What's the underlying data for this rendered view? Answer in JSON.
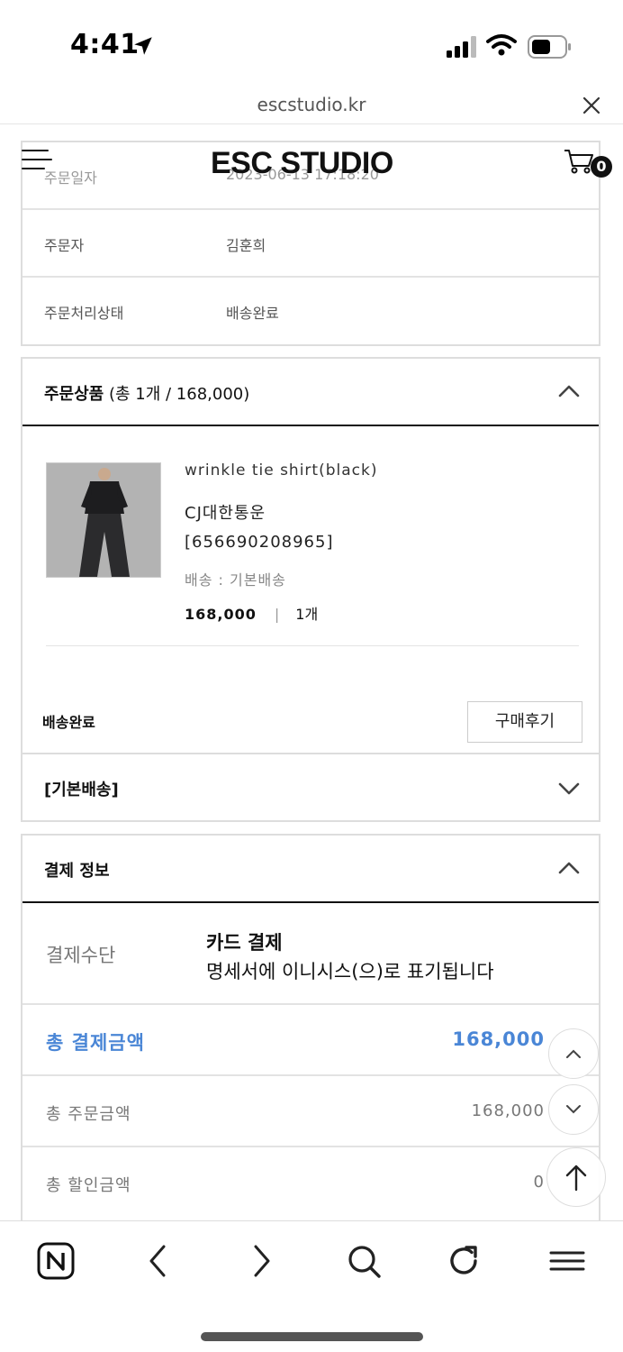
{
  "status_bar": {
    "time": "4:41"
  },
  "browser": {
    "url": "escstudio.kr"
  },
  "header": {
    "logo": "ESC STUDIO",
    "cart_count": "0"
  },
  "order_info": [
    {
      "label": "주문일자",
      "value": "2023-06-13 17:18:20"
    },
    {
      "label": "주문자",
      "value": "김훈희"
    },
    {
      "label": "주문처리상태",
      "value": "배송완료"
    }
  ],
  "products_section": {
    "title": "주문상품",
    "summary": "(총 1개 / 168,000)",
    "item": {
      "name": "wrinkle tie shirt(black)",
      "carrier": "CJ대한통운",
      "tracking": "[656690208965]",
      "shipping_type": "배송 : 기본배송",
      "price": "168,000",
      "quantity": "1개"
    },
    "status": "배송완료",
    "review_button": "구매후기"
  },
  "basic_shipping": {
    "label": "[기본배송]"
  },
  "payment": {
    "title": "결제 정보",
    "method_label": "결제수단",
    "method": "카드 결제",
    "method_note": "명세서에 이니시스(으)로 표기됩니다",
    "rows": [
      {
        "label": "총 결제금액",
        "value": "168,000"
      },
      {
        "label": "총 주문금액",
        "value": "168,000"
      },
      {
        "label": "총 할인금액",
        "value": "0"
      }
    ]
  },
  "colors": {
    "accent": "#4a86d6",
    "border": "#dddddd"
  }
}
